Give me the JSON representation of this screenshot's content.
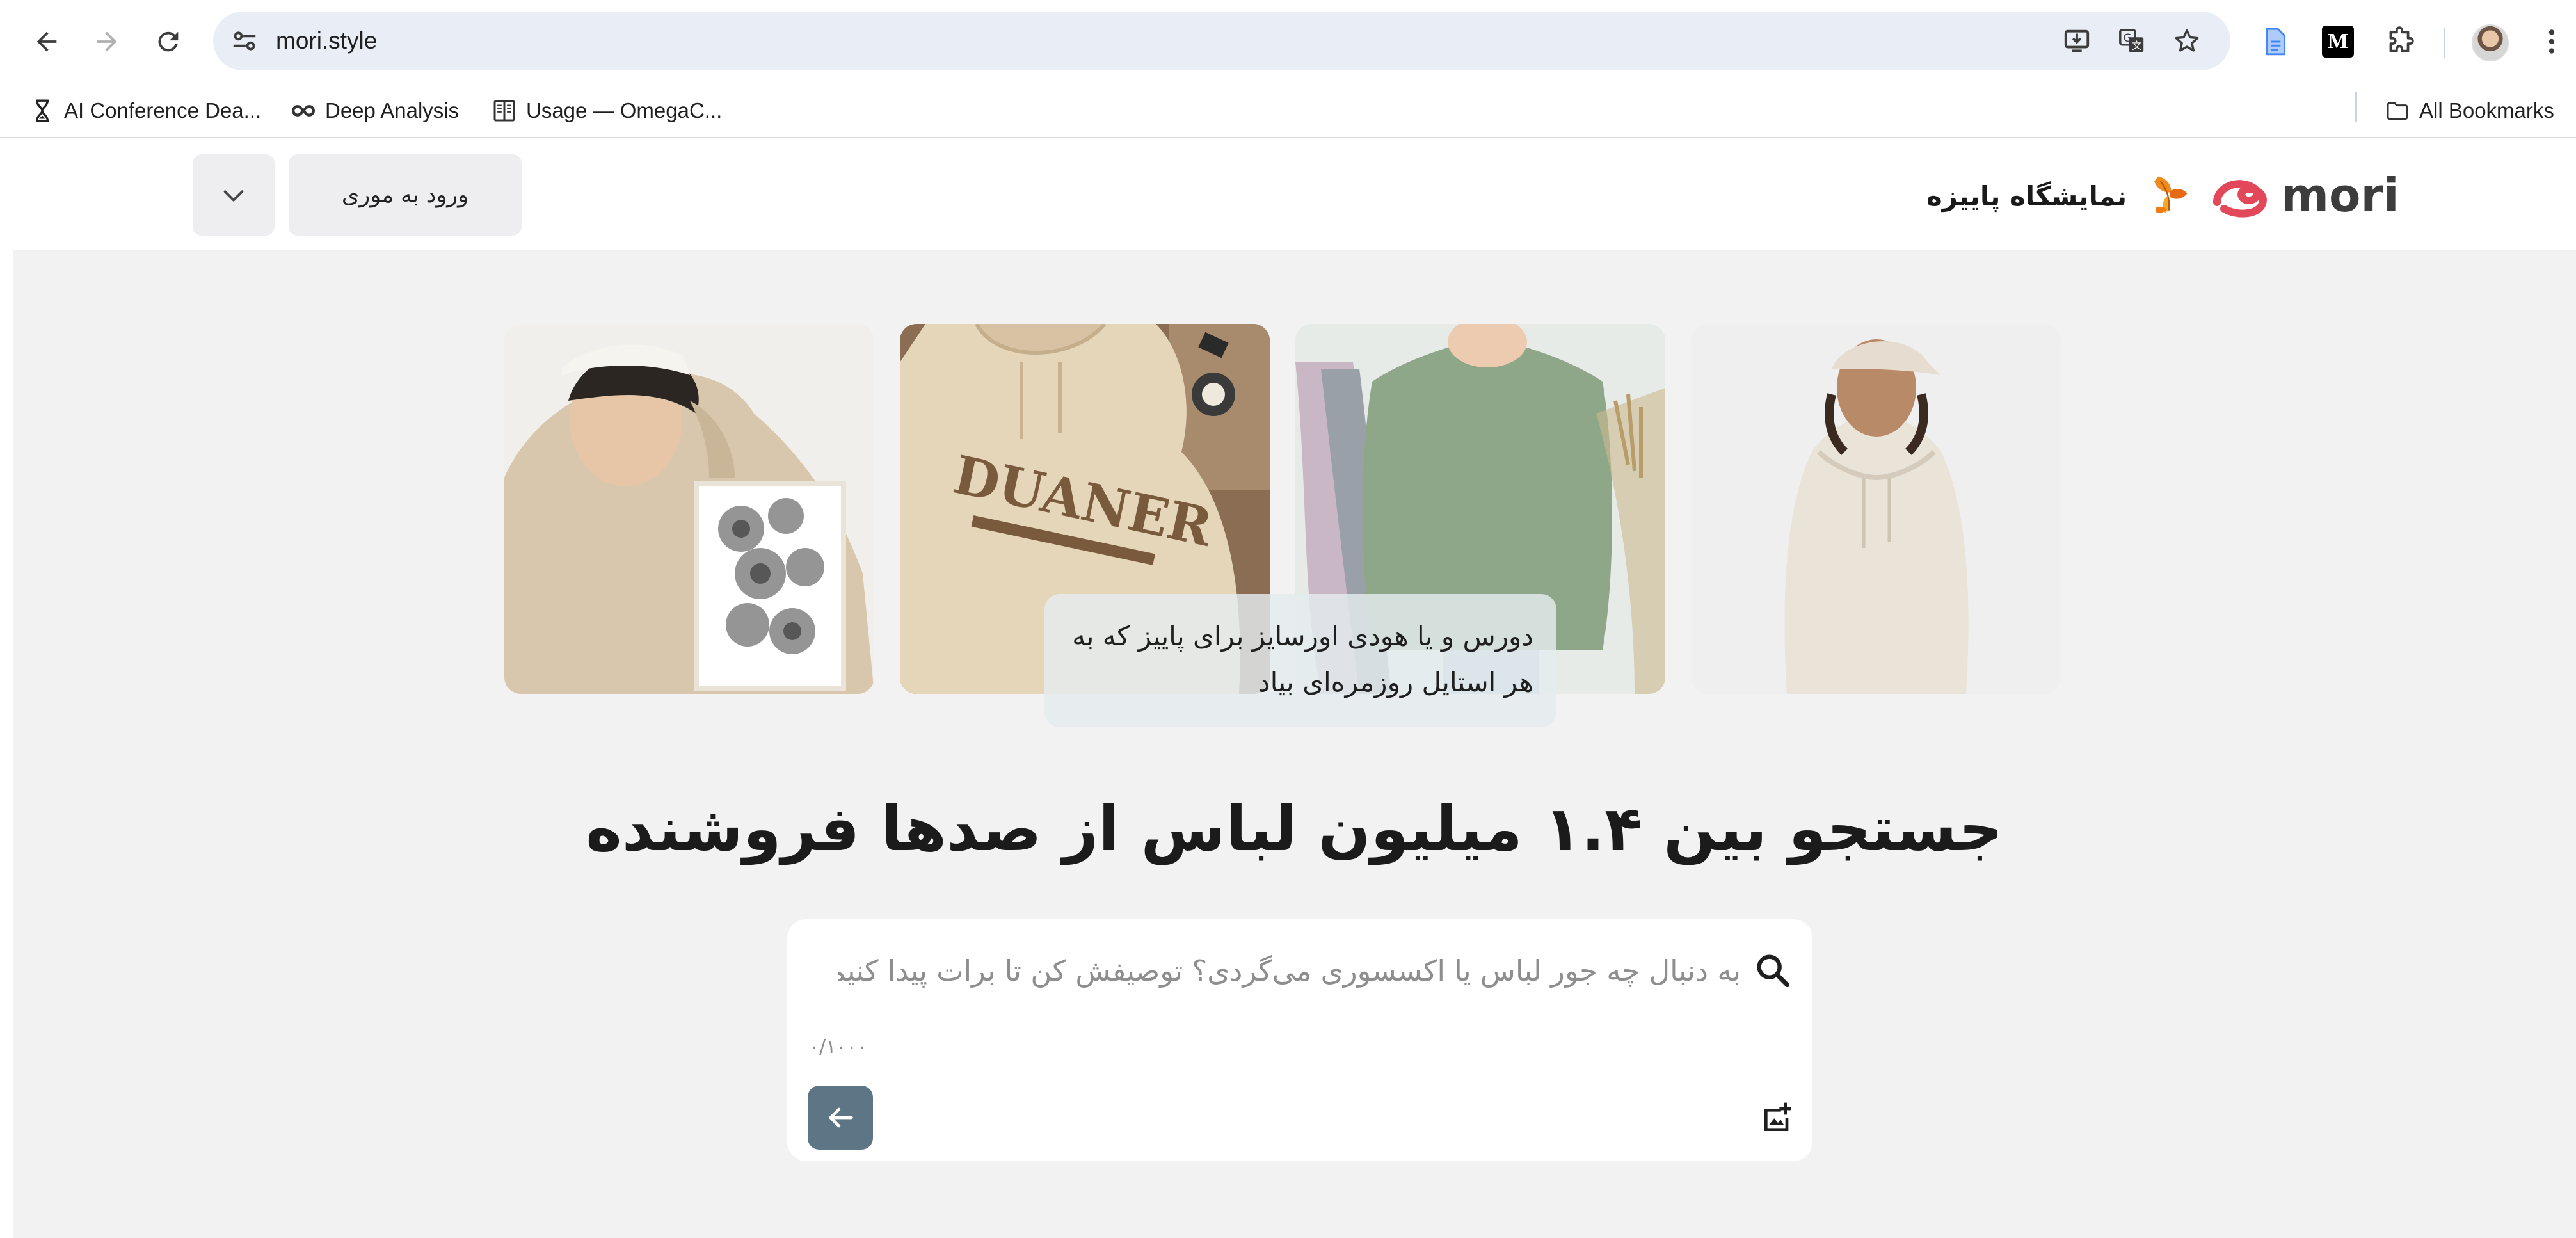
{
  "browser": {
    "url": "mori.style",
    "bookmarks": [
      {
        "label": "AI Conference Dea...",
        "icon": "hourglass-icon"
      },
      {
        "label": "Deep Analysis",
        "icon": "infinity-icon"
      },
      {
        "label": "Usage — OmegaC...",
        "icon": "book-icon"
      }
    ],
    "all_bookmarks_label": "All Bookmarks",
    "extension_m_label": "M"
  },
  "header": {
    "logo_text": "mori",
    "autumn_label": "نمایشگاه پاییزه",
    "login_label": "ورود به موری"
  },
  "hero": {
    "cards": [
      {
        "alt": "woman in beige hoodie and cap"
      },
      {
        "alt": "woman in green sweatshirt"
      },
      {
        "alt": "beige DUANER hoodie"
      },
      {
        "alt": "man in beige hoodie with flower print"
      }
    ],
    "card_print_text": "DUANER",
    "caption": "دورس و یا هودی اورسایز برای پاییز که به هر استایل روزمره‌ای بیاد",
    "headline": "جستجو بین ۱.۴ میلیون لباس از صدها فروشنده"
  },
  "search": {
    "placeholder": "به دنبال چه جور لباس یا اکسسوری می‌گردی؟ توصیفش کن تا برات پیدا کنیم.",
    "value": "",
    "counter": "۰/۱۰۰۰"
  },
  "colors": {
    "logo_red": "#e2485a",
    "logo_dark": "#3d3d3d",
    "submit_button": "#5e7586",
    "page_background": "#f2f2f2",
    "omnibox": "#e9eef6"
  }
}
